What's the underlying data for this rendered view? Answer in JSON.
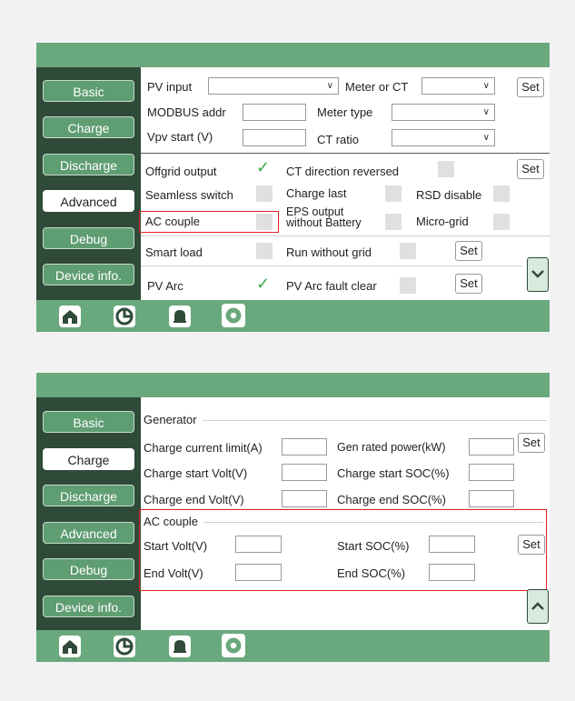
{
  "sidebar": {
    "items": [
      "Basic",
      "Charge",
      "Discharge",
      "Advanced",
      "Debug",
      "Device info."
    ]
  },
  "advanced": {
    "pv_input": "PV input",
    "meter_or_ct": "Meter or CT",
    "modbus_addr": "MODBUS addr",
    "meter_type": "Meter type",
    "vpv_start": "Vpv start (V)",
    "ct_ratio": "CT ratio",
    "set": "Set",
    "offgrid_output": "Offgrid output",
    "ct_direction_reversed": "CT direction reversed",
    "seamless_switch": "Seamless switch",
    "charge_last": "Charge last",
    "rsd_disable": "RSD disable",
    "ac_couple": "AC couple",
    "eps_output_line1": "EPS output",
    "eps_output_line2": "without Battery",
    "micro_grid": "Micro-grid",
    "smart_load": "Smart load",
    "run_without_grid": "Run without grid",
    "pv_arc": "PV Arc",
    "pv_arc_fault_clear": "PV Arc fault clear"
  },
  "charge": {
    "generator": "Generator",
    "charge_current_limit": "Charge current limit(A)",
    "gen_rated_power": "Gen rated power(kW)",
    "charge_start_volt": "Charge start Volt(V)",
    "charge_start_soc": "Charge start SOC(%)",
    "charge_end_volt": "Charge end Volt(V)",
    "charge_end_soc": "Charge end SOC(%)",
    "ac_couple": "AC couple",
    "start_volt": "Start Volt(V)",
    "start_soc": "Start SOC(%)",
    "end_volt": "End Volt(V)",
    "end_soc": "End SOC(%)",
    "set": "Set"
  },
  "icons": [
    "home-icon",
    "pie-chart-icon",
    "bell-icon",
    "gear-icon"
  ],
  "colors": {
    "accent": "#6aa87d",
    "sidebar": "#2f4a38",
    "highlight": "#e02020",
    "check": "#3ea84d"
  }
}
